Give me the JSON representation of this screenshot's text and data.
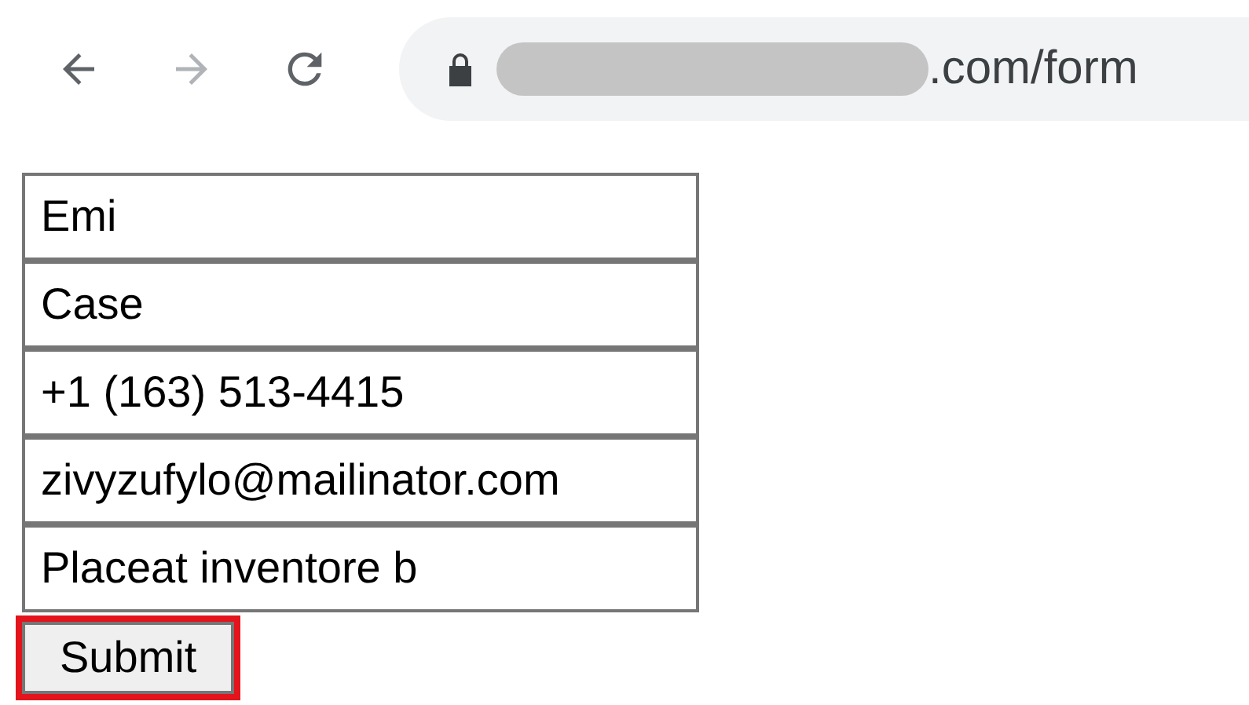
{
  "toolbar": {
    "buttons": [
      {
        "kind": "back",
        "disabled": false
      },
      {
        "kind": "forward",
        "disabled": true
      },
      {
        "kind": "reload",
        "disabled": false
      }
    ],
    "address": {
      "secure": true,
      "url": ".com/form"
    }
  },
  "form": {
    "fields": [
      {
        "value": "Emi"
      },
      {
        "value": "Case"
      },
      {
        "value": "+1 (163) 513-4415"
      },
      {
        "value": "zivyzufylo@mailinator.com"
      },
      {
        "value": "Placeat inventore b"
      }
    ],
    "submit": {
      "label": "Submit",
      "highlighted": true
    }
  }
}
